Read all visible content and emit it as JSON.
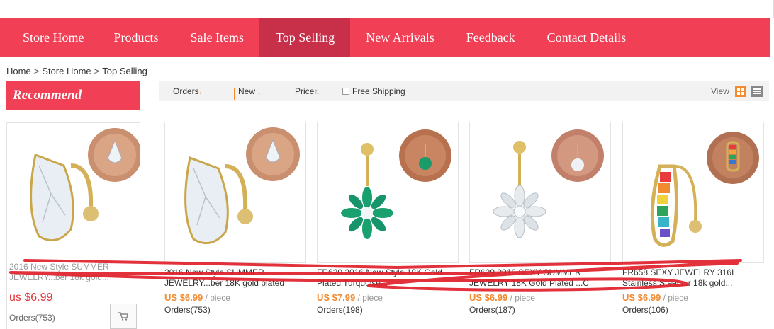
{
  "nav": {
    "items": [
      {
        "label": "Store Home"
      },
      {
        "label": "Products"
      },
      {
        "label": "Sale Items"
      },
      {
        "label": "Top Selling",
        "active": true
      },
      {
        "label": "New Arrivals"
      },
      {
        "label": "Feedback"
      },
      {
        "label": "Contact Details"
      }
    ]
  },
  "breadcrumb": {
    "home": "Home",
    "sep": ">",
    "store_home": "Store Home",
    "current": "Top Selling"
  },
  "recommend": {
    "heading": "Recommend",
    "item": {
      "title": "2016 New Style SUMMER JEWELRY...ber 18k gold...",
      "price": "us $6.99",
      "orders": "Orders(753)"
    }
  },
  "toolbar": {
    "orders_label": "Orders",
    "new_label": "New",
    "price_label": "Price",
    "free_shipping_label": "Free Shipping",
    "view_label": "View"
  },
  "products": [
    {
      "title": "2016 New Style SUMMER JEWELRY...ber 18K gold plated",
      "price": "US $6.99",
      "unit": "/ piece",
      "orders": "Orders(753)",
      "icon": "teardrop-crystal-ring"
    },
    {
      "title": "FR620 2016 New Style 18K Gold Plated Turquoise...",
      "price": "US $7.99",
      "unit": "/ piece",
      "orders": "Orders(198)",
      "icon": "green-flower-belly-ring"
    },
    {
      "title": "FR629 2016 SEXY SUMMER JEWELRY 18K Gold Plated ...C",
      "price": "US $6.99",
      "unit": "/ piece",
      "orders": "Orders(187)",
      "icon": "clear-flower-belly-ring"
    },
    {
      "title": "FR658 SEXY JEWELRY 316L Stainless Steel ...r 18k gold...",
      "price": "US $6.99",
      "unit": "/ piece",
      "orders": "Orders(106)",
      "icon": "rainbow-crystal-belly-ring"
    }
  ],
  "colors": {
    "brand": "#f13f55",
    "brand_active": "#c8304a",
    "price_orange": "#f28a30",
    "price_red": "#e4393c",
    "scribble": "#e0202a"
  }
}
